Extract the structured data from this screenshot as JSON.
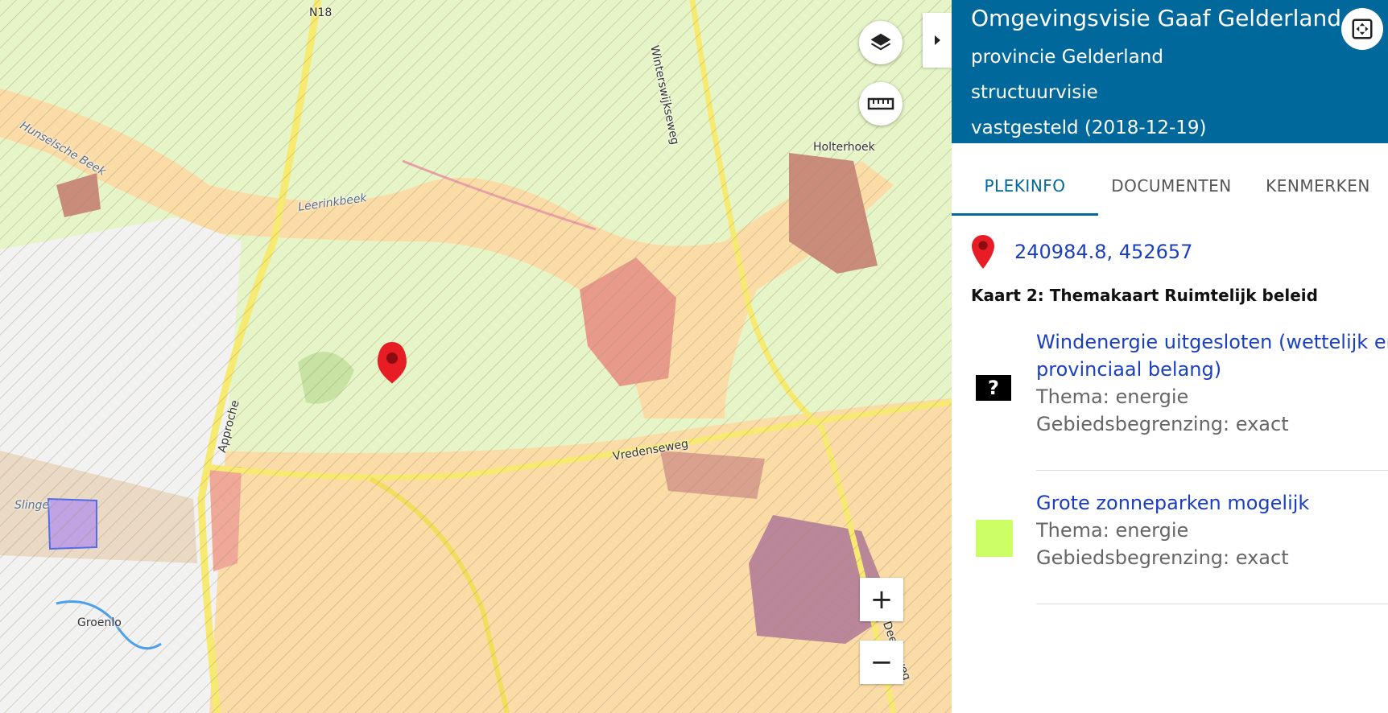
{
  "map": {
    "labels": {
      "road_n18": "N18",
      "road_winterswijkseweg": "Winterswijkseweg",
      "place_holterhoek": "Holterhoek",
      "water_hunselsche_beek": "Hunselsche Beek",
      "water_leerinkbeek": "Leerinkbeek",
      "road_approche": "Approche",
      "road_vredenseweg": "Vredenseweg",
      "water_slinge": "Slinge",
      "place_groenlo": "Groenlo",
      "road_deelseweg": "Deelseweg"
    },
    "controls": {
      "layers_icon": "layers-icon",
      "measure_icon": "ruler-icon",
      "toggle_icon": "caret-right-icon",
      "zoom_in_label": "+",
      "zoom_out_label": "−"
    },
    "colors": {
      "green_zone": "#e6f5c7",
      "orange_zone": "#fbdca6",
      "road": "#f3e86a",
      "marker": "#e81c24",
      "hatch": "#b09c7a"
    }
  },
  "panel": {
    "header": {
      "title": "Omgevingsvisie Gaaf Gelderland",
      "line1": "provincie Gelderland",
      "line2": "structuurvisie",
      "line3": "vastgesteld (2018-12-19)",
      "fullscreen_icon": "expand-arrows-icon"
    },
    "tabs": [
      {
        "label": "PLEKINFO",
        "active": true
      },
      {
        "label": "DOCUMENTEN",
        "active": false
      },
      {
        "label": "KENMERKEN",
        "active": false
      }
    ],
    "location": {
      "icon": "map-pin-icon",
      "coords": "240984.8, 452657"
    },
    "map_title": "Kaart 2: Themakaart Ruimtelijk beleid",
    "items": [
      {
        "name_line1": "Windenergie uitgesloten (wettelijk en",
        "name_line2": "provinciaal belang)",
        "thema": "Thema: energie",
        "begrenzing": "Gebiedsbegrenzing: exact",
        "swatch_icon": "question-mark-icon",
        "swatch_label": "?",
        "swatch_color": "#000000"
      },
      {
        "name_line1": "Grote zonneparken mogelijk",
        "thema": "Thema: energie",
        "begrenzing": "Gebiedsbegrenzing: exact",
        "swatch_color": "#ccff66"
      }
    ],
    "colors": {
      "header_bg": "#01689b",
      "link": "#1a3fc0"
    }
  }
}
